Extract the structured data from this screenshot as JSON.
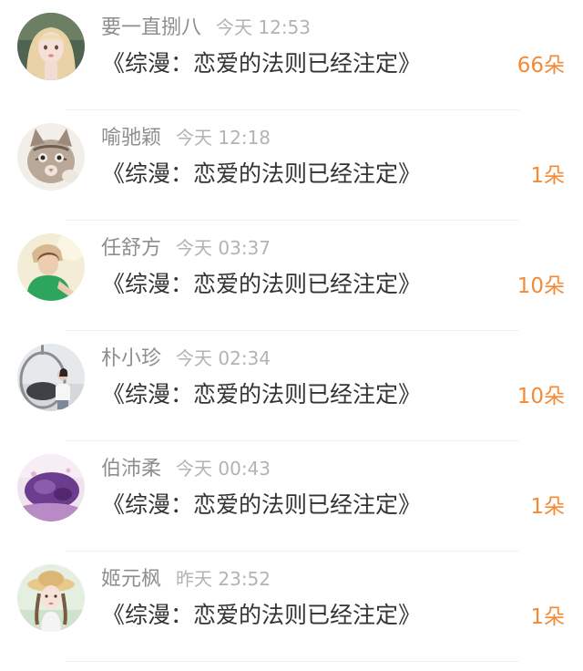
{
  "colors": {
    "name": "#8e8e8e",
    "time": "#b3b3b3",
    "work_title": "#333333",
    "count": "#f58a35",
    "divider": "#f1f1f1"
  },
  "entries": [
    {
      "user": "要一直捌八",
      "time": "今天 12:53",
      "work": "《综漫：恋爱的法则已经注定》",
      "count": "66朵",
      "avatar_icon": "avatar-girl-illustration"
    },
    {
      "user": "喻驰颖",
      "time": "今天 12:18",
      "work": "《综漫：恋爱的法则已经注定》",
      "count": "1朵",
      "avatar_icon": "avatar-cat-photo"
    },
    {
      "user": "任舒方",
      "time": "今天 03:37",
      "work": "《综漫：恋爱的法则已经注定》",
      "count": "10朵",
      "avatar_icon": "avatar-girl-green-shirt"
    },
    {
      "user": "朴小珍",
      "time": "今天 02:34",
      "work": "《综漫：恋爱的法则已经注定》",
      "count": "10朵",
      "avatar_icon": "avatar-hanging-chair-photo"
    },
    {
      "user": "伯沛柔",
      "time": "今天 00:43",
      "work": "《综漫：恋爱的法则已经注定》",
      "count": "1朵",
      "avatar_icon": "avatar-purple-pillow-photo"
    },
    {
      "user": "姬元枫",
      "time": "昨天 23:52",
      "work": "《综漫：恋爱的法则已经注定》",
      "count": "1朵",
      "avatar_icon": "avatar-girl-braids-straw-hat"
    }
  ]
}
